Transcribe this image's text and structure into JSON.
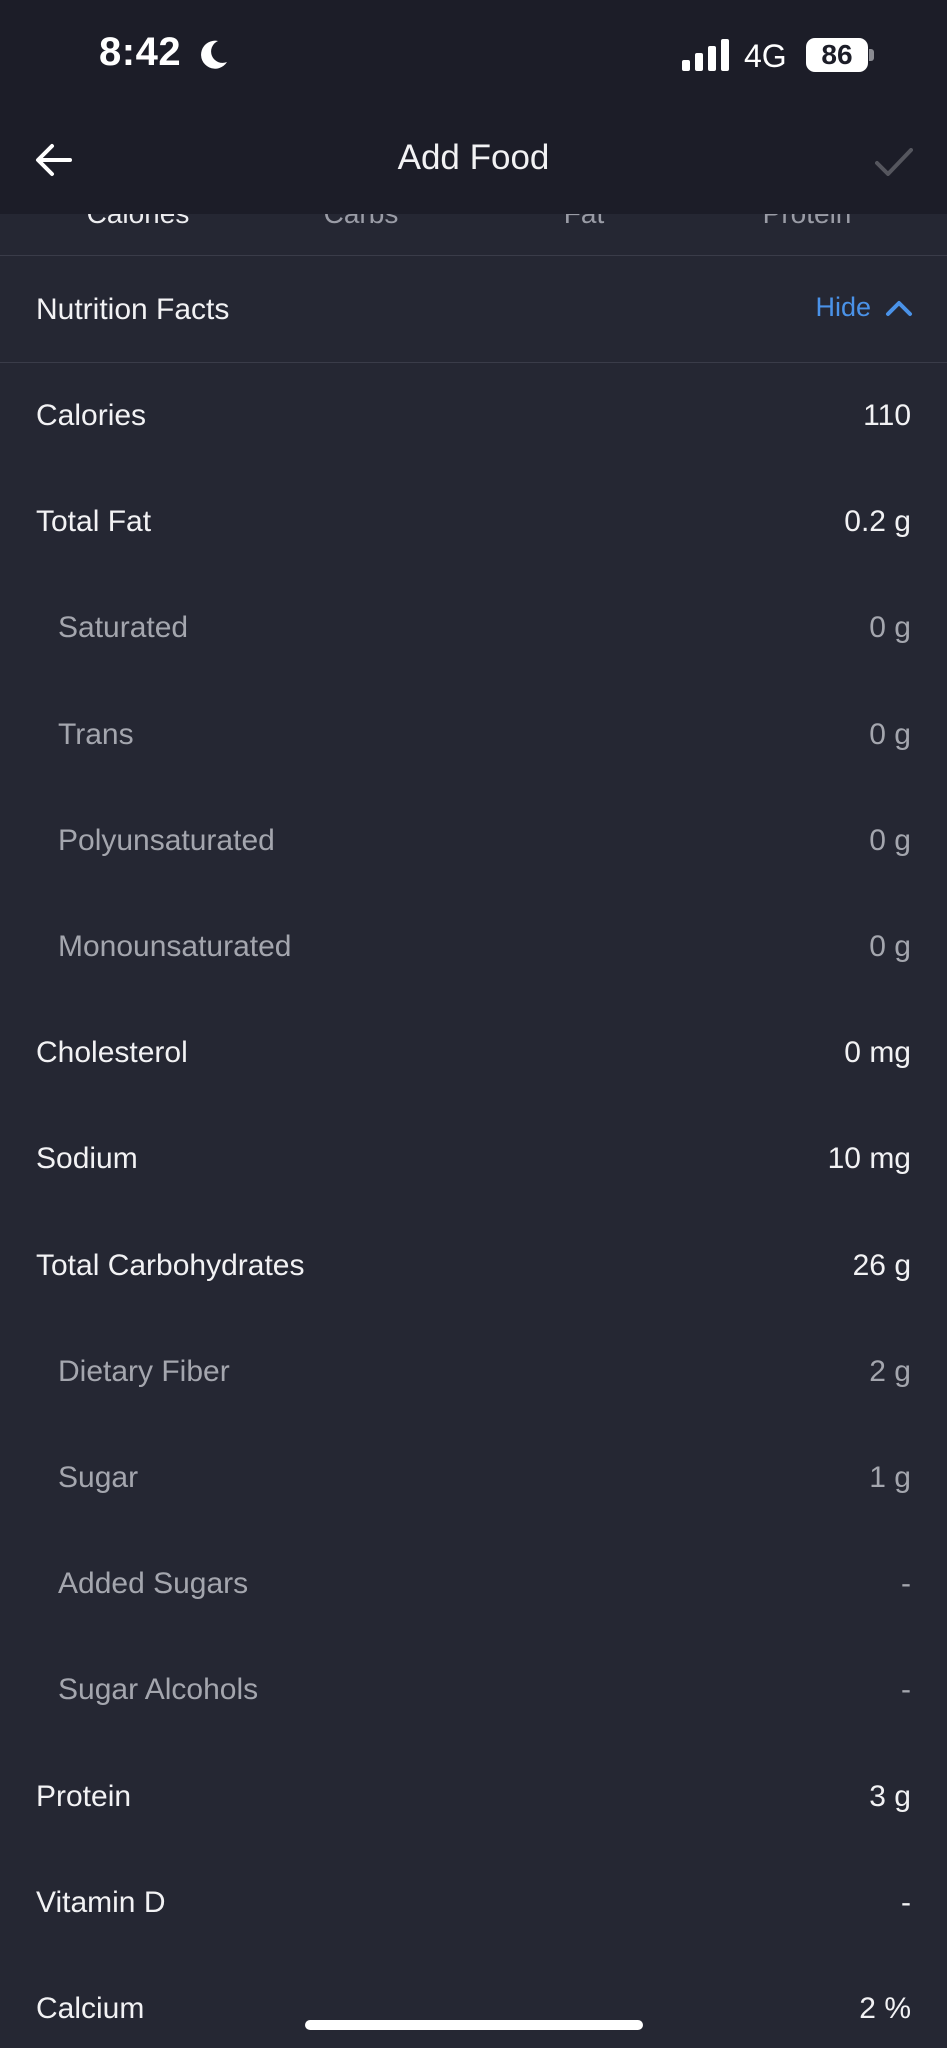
{
  "status_bar": {
    "time": "8:42",
    "network": "4G",
    "battery": "86",
    "icons": [
      "moon-icon",
      "signal-bars-icon",
      "battery-icon"
    ]
  },
  "header": {
    "title": "Add Food",
    "icons": [
      "back-arrow-icon",
      "checkmark-icon"
    ]
  },
  "macro_tabs": [
    "Calories",
    "Carbs",
    "Fat",
    "Protein"
  ],
  "nutrition_facts": {
    "title": "Nutrition Facts",
    "toggle_label": "Hide",
    "toggle_icon": "chevron-up-icon",
    "accent_color": "#4a92e8",
    "rows": [
      {
        "name": "Calories",
        "value": "110"
      },
      {
        "name": "Total Fat",
        "value": "0.2 g"
      },
      {
        "name": "Saturated",
        "value": "0 g"
      },
      {
        "name": "Trans",
        "value": "0 g"
      },
      {
        "name": "Polyunsaturated",
        "value": "0 g"
      },
      {
        "name": "Monounsaturated",
        "value": "0 g"
      },
      {
        "name": "Cholesterol",
        "value": "0 mg"
      },
      {
        "name": "Sodium",
        "value": "10 mg"
      },
      {
        "name": "Total Carbohydrates",
        "value": "26 g"
      },
      {
        "name": "Dietary Fiber",
        "value": "2 g"
      },
      {
        "name": "Sugar",
        "value": "1 g"
      },
      {
        "name": "Added Sugars",
        "value": "-"
      },
      {
        "name": "Sugar Alcohols",
        "value": "-"
      },
      {
        "name": "Protein",
        "value": "3 g"
      },
      {
        "name": "Vitamin D",
        "value": "-"
      },
      {
        "name": "Calcium",
        "value": "2 %"
      }
    ]
  }
}
